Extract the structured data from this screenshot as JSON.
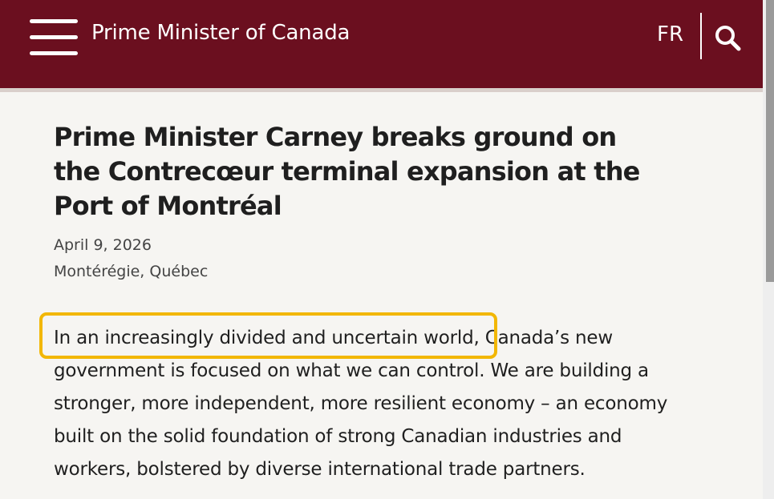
{
  "header": {
    "site_title": "Prime Minister of Canada",
    "language_toggle": "FR",
    "background_color": "#6b0f1f",
    "menu_icon": "hamburger-menu-icon",
    "search_icon": "search-icon"
  },
  "article": {
    "title": "Prime Minister Carney breaks ground on the Contrecœur terminal expansion at the Port of Montréal",
    "date": "April 9, 2026",
    "location": "Montérégie, Québec",
    "body_highlighted": "In an increasingly divided and uncertain world,",
    "body_rest": " Canada’s new government is focused on what we can control. We are building a stronger, more independent, more resilient economy – an economy built on the solid foundation of strong Canadian industries and workers, bolstered by diverse international trade partners."
  },
  "highlight": {
    "color": "#f2b705"
  }
}
